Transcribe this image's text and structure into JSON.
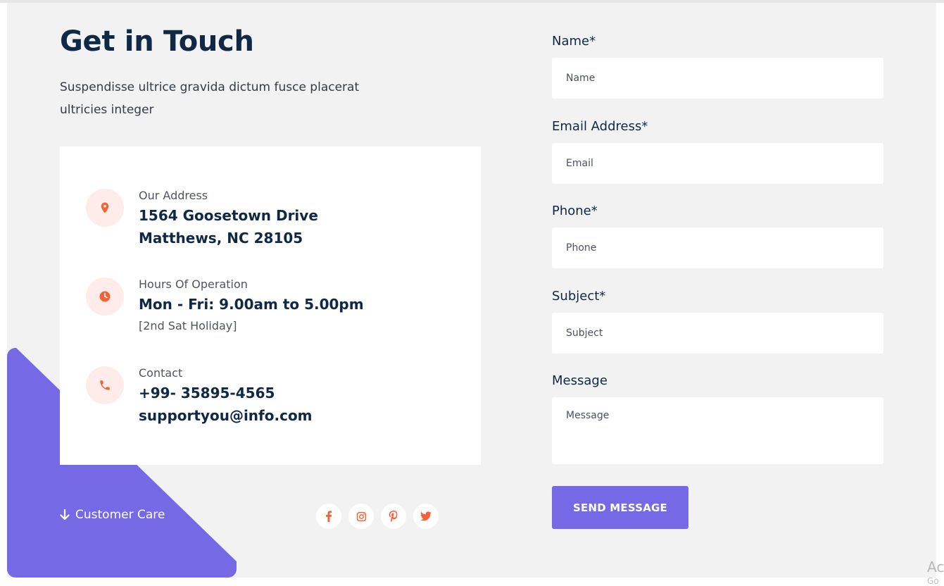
{
  "contact": {
    "title": "Get in Touch",
    "lead": "Suspendisse ultrice gravida dictum fusce placerat ultricies integer",
    "address": {
      "label": "Our Address",
      "line1": "1564 Goosetown Drive",
      "line2": "Matthews, NC 28105",
      "icon": "location-pin-icon"
    },
    "hours": {
      "label": "Hours Of Operation",
      "value": "Mon - Fri: 9.00am to 5.00pm",
      "note": "[2nd Sat Holiday]",
      "icon": "clock-icon"
    },
    "phone": {
      "label": "Contact",
      "phone": "+99- 35895-4565",
      "email": "supportyou@info.com",
      "icon": "phone-icon"
    },
    "customer_care": "Customer Care",
    "social": [
      "facebook",
      "instagram",
      "pinterest",
      "twitter"
    ]
  },
  "form": {
    "name": {
      "label": "Name*",
      "placeholder": "Name"
    },
    "email": {
      "label": "Email Address*",
      "placeholder": "Email"
    },
    "phone": {
      "label": "Phone*",
      "placeholder": "Phone"
    },
    "subject": {
      "label": "Subject*",
      "placeholder": "Subject"
    },
    "message": {
      "label": "Message",
      "placeholder": "Message"
    },
    "submit": "SEND MESSAGE"
  },
  "overlay": {
    "line1": "Ac",
    "line2": "Go"
  },
  "colors": {
    "accent": "#7669e6",
    "icon": "#f4623a",
    "heading": "#0f2846",
    "icon_bg": "#fdece9"
  }
}
